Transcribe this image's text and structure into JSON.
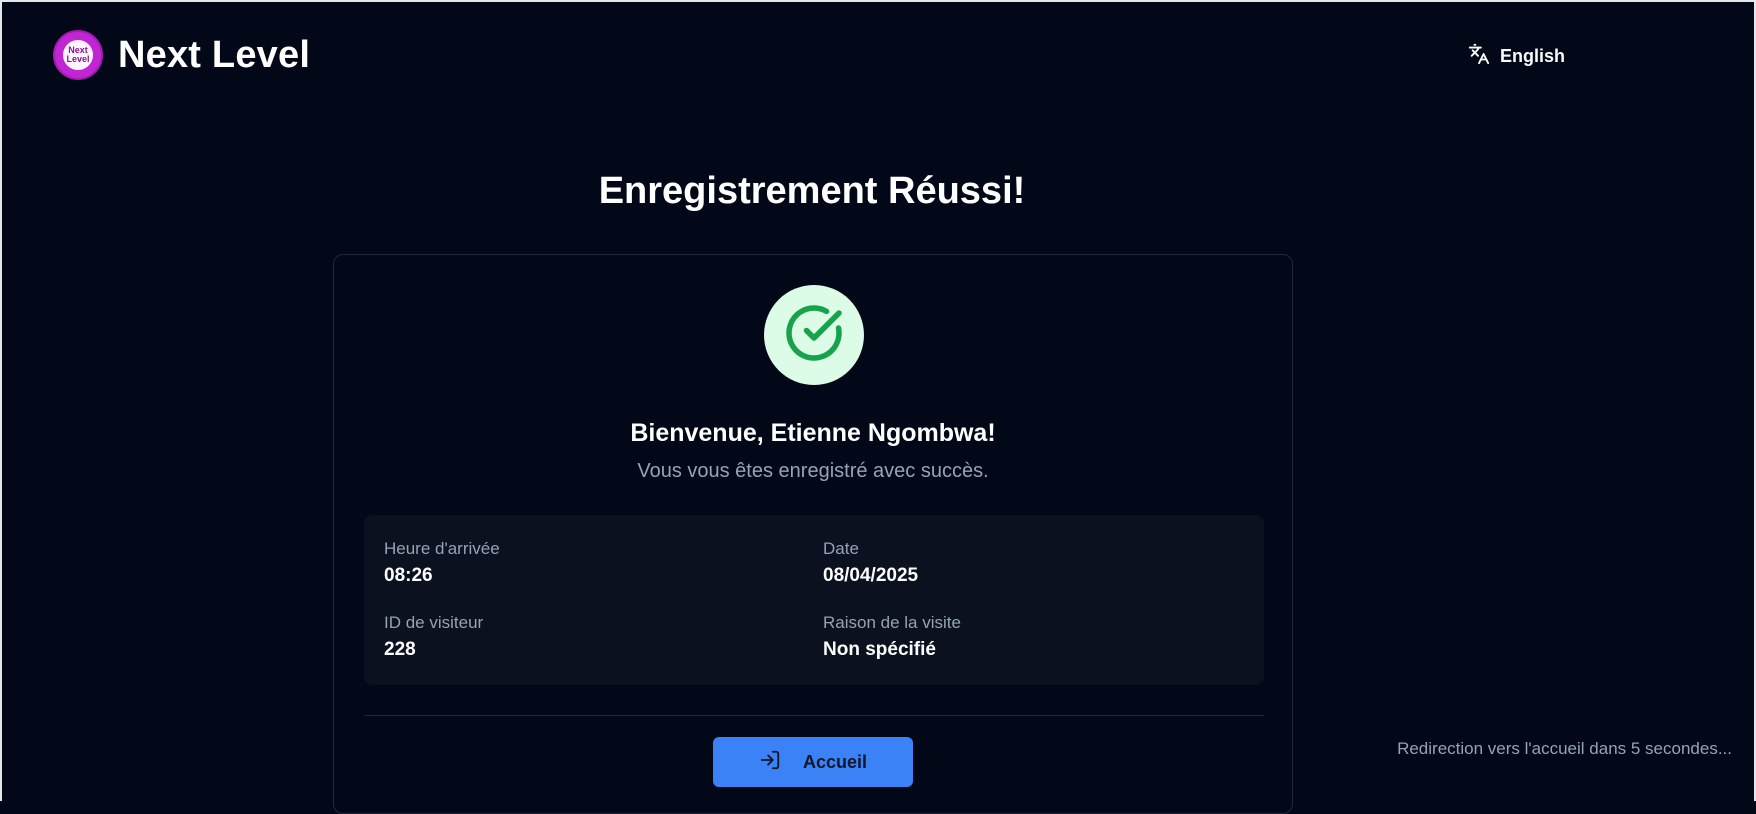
{
  "header": {
    "brand": "Next Level",
    "logo_text": "Next Level",
    "language_label": "English",
    "language_icon": "translate-icon"
  },
  "page": {
    "title": "Enregistrement Réussi!"
  },
  "card": {
    "status_icon": "check-circle-icon",
    "welcome": "Bienvenue, Etienne Ngombwa!",
    "subtitle": "Vous vous êtes enregistré avec succès.",
    "details": {
      "arrival_label": "Heure d'arrivée",
      "arrival_value": "08:26",
      "date_label": "Date",
      "date_value": "08/04/2025",
      "visitor_id_label": "ID de visiteur",
      "visitor_id_value": "228",
      "reason_label": "Raison de la visite",
      "reason_value": "Non spécifié"
    },
    "home_button": {
      "label": "Accueil",
      "icon": "log-in-icon"
    }
  },
  "redirect_notice": "Redirection vers l'accueil dans 5 secondes...",
  "colors": {
    "background": "#020817",
    "accent": "#3b82f6",
    "success": "#16a34a",
    "success_bg": "#dcfce7",
    "logo": "#c026d3"
  }
}
